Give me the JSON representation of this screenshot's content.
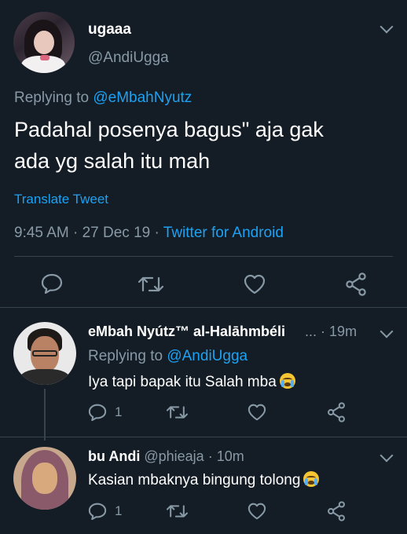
{
  "main_tweet": {
    "display_name": "ugaaa",
    "handle": "@AndiUgga",
    "replying_prefix": "Replying to",
    "replying_to": "@eMbahNyutz",
    "text_line1": "Padahal posenya bagus\" aja gak",
    "text_line2": "ada yg salah itu mah",
    "translate": "Translate Tweet",
    "time": "9:45 AM",
    "date": "27 Dec 19",
    "source": "Twitter for Android",
    "sep": "·"
  },
  "replies": [
    {
      "display_name": "eMbah Nyútz™ al-Halāhmbéli",
      "ellipsis": "...",
      "time": "19m",
      "replying_prefix": "Replying to",
      "replying_to": "@AndiUgga",
      "text": "Iya tapi bapak itu Salah mba",
      "reply_count": "1"
    },
    {
      "display_name": "bu Andi",
      "handle": "@phieaja",
      "time": "10m",
      "text": "Kasian mbaknya bingung tolong",
      "reply_count": "1"
    }
  ],
  "icons": [
    "reply-icon",
    "retweet-icon",
    "like-icon",
    "share-icon",
    "chevron-down-icon",
    "loudly-crying-emoji"
  ],
  "colors": {
    "background": "#141d26",
    "link": "#1da1f2",
    "secondary": "#8899a6",
    "divider": "#38444d"
  }
}
